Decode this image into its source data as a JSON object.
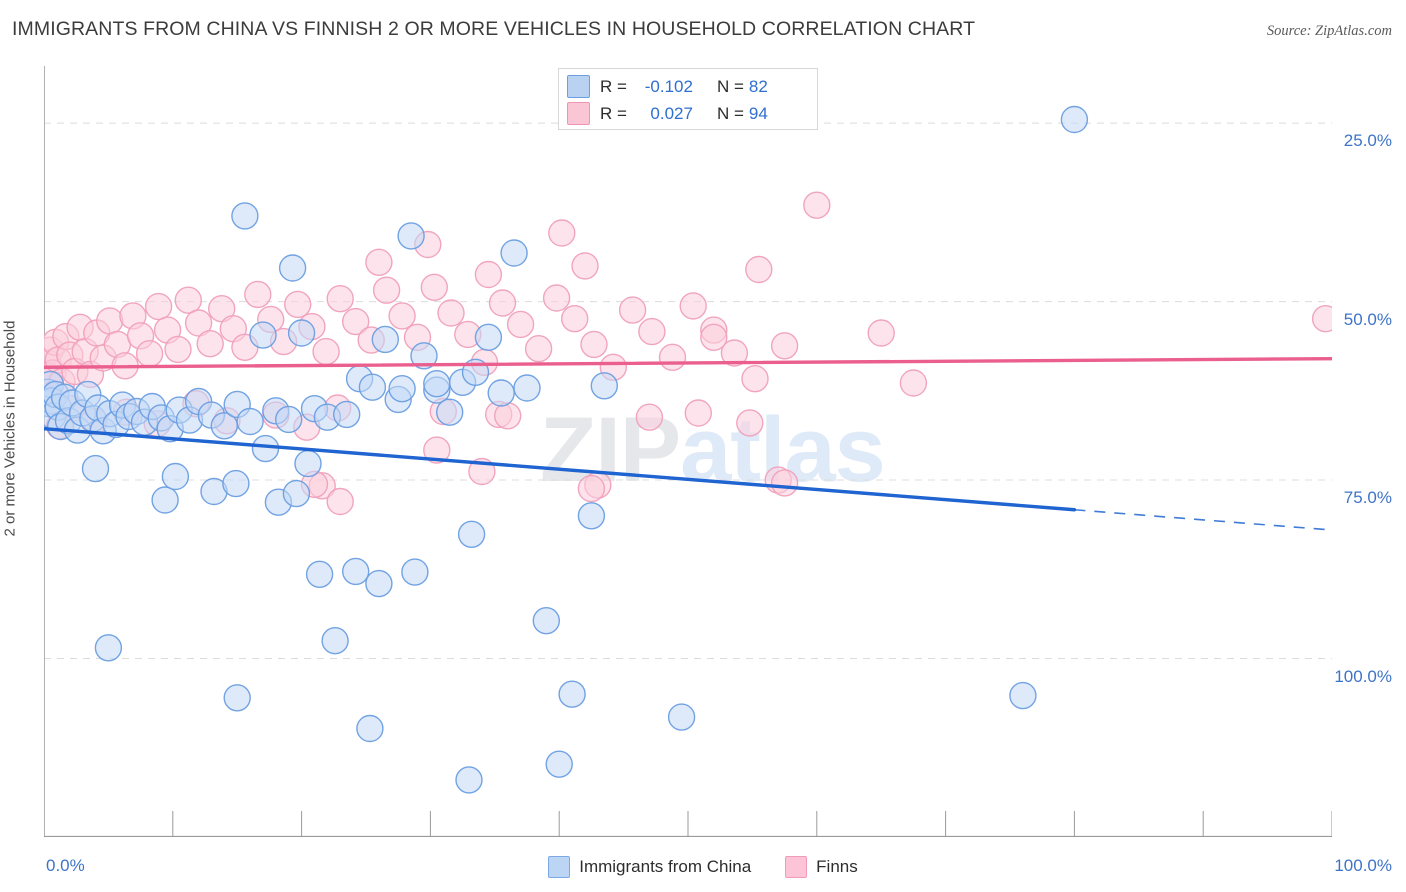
{
  "title": "IMMIGRANTS FROM CHINA VS FINNISH 2 OR MORE VEHICLES IN HOUSEHOLD CORRELATION CHART",
  "source": "Source: ZipAtlas.com",
  "watermark": {
    "part1": "ZIP",
    "part2": "atlas"
  },
  "colors": {
    "blue_fill": "#c3d8f5",
    "blue_stroke": "#6a9ee2",
    "blue_line": "#1f64d0",
    "pink_fill": "#fccedd",
    "pink_stroke": "#f0a0ba",
    "pink_line": "#ea5f8e",
    "axis_label": "#3e74c8",
    "gridline": "#dcdcdc"
  },
  "correlation_legend": [
    {
      "series": "Immigrants from China",
      "swatch": "blue",
      "r_label": "R =",
      "r_value": "-0.102",
      "n_label": "N =",
      "n_value": "82"
    },
    {
      "series": "Finns",
      "swatch": "pink",
      "r_label": "R =",
      "r_value": "0.027",
      "n_label": "N =",
      "n_value": "94"
    }
  ],
  "series_legend": [
    {
      "label": "Immigrants from China",
      "swatch": "blue"
    },
    {
      "label": "Finns",
      "swatch": "pink"
    }
  ],
  "axes": {
    "y_title": "2 or more Vehicles in Household",
    "y_ticks": [
      "100.0%",
      "75.0%",
      "50.0%",
      "25.0%"
    ],
    "x_min_label": "0.0%",
    "x_max_label": "100.0%"
  },
  "chart_data": {
    "type": "scatter",
    "title": "IMMIGRANTS FROM CHINA VS FINNISH 2 OR MORE VEHICLES IN HOUSEHOLD CORRELATION CHART",
    "xlabel": "",
    "ylabel": "2 or more Vehicles in Household",
    "xlim": [
      0,
      100
    ],
    "ylim": [
      0,
      108
    ],
    "x_ticks": [
      0,
      10,
      20,
      30,
      40,
      50,
      60,
      70,
      80,
      90,
      100
    ],
    "y_ticks": [
      25,
      50,
      75,
      100
    ],
    "grid": true,
    "legend_position": "bottom-center",
    "series": [
      {
        "name": "Immigrants from China",
        "color": "#c3d8f5",
        "r": -0.102,
        "n": 82,
        "trendline": {
          "x0": 0,
          "y0": 57.2,
          "x1": 100,
          "y1": 43.0,
          "solid_until_x": 80
        },
        "points": [
          [
            0.3,
            62.3
          ],
          [
            0.4,
            60.7
          ],
          [
            0.5,
            63.4
          ],
          [
            0.6,
            61.1
          ],
          [
            0.7,
            59.0
          ],
          [
            0.9,
            62.0
          ],
          [
            1.1,
            60.2
          ],
          [
            1.3,
            57.5
          ],
          [
            1.6,
            61.6
          ],
          [
            1.9,
            58.3
          ],
          [
            2.2,
            60.8
          ],
          [
            2.6,
            57.0
          ],
          [
            3.0,
            59.4
          ],
          [
            3.4,
            62.0
          ],
          [
            3.8,
            58.6
          ],
          [
            4.2,
            60.1
          ],
          [
            4.6,
            56.9
          ],
          [
            5.1,
            59.3
          ],
          [
            5.6,
            57.8
          ],
          [
            6.1,
            60.5
          ],
          [
            4.0,
            51.6
          ],
          [
            6.6,
            58.9
          ],
          [
            7.2,
            59.6
          ],
          [
            7.8,
            58.1
          ],
          [
            8.4,
            60.3
          ],
          [
            9.1,
            58.7
          ],
          [
            9.8,
            57.2
          ],
          [
            10.5,
            59.8
          ],
          [
            11.3,
            58.4
          ],
          [
            12.0,
            61.0
          ],
          [
            9.4,
            47.2
          ],
          [
            10.2,
            50.5
          ],
          [
            13.0,
            59.1
          ],
          [
            14.0,
            57.6
          ],
          [
            15.0,
            60.6
          ],
          [
            13.2,
            48.4
          ],
          [
            16.0,
            58.2
          ],
          [
            17.0,
            70.3
          ],
          [
            15.6,
            87.0
          ],
          [
            18.0,
            59.7
          ],
          [
            14.9,
            49.5
          ],
          [
            19.0,
            58.5
          ],
          [
            20.0,
            70.6
          ],
          [
            19.3,
            79.7
          ],
          [
            21.0,
            60.0
          ],
          [
            18.2,
            46.9
          ],
          [
            22.0,
            58.8
          ],
          [
            17.2,
            54.4
          ],
          [
            20.5,
            52.3
          ],
          [
            23.5,
            59.2
          ],
          [
            19.6,
            48.1
          ],
          [
            24.5,
            64.2
          ],
          [
            25.5,
            63.0
          ],
          [
            21.4,
            36.8
          ],
          [
            26.5,
            69.7
          ],
          [
            27.5,
            61.3
          ],
          [
            24.2,
            37.2
          ],
          [
            28.5,
            84.2
          ],
          [
            29.5,
            67.4
          ],
          [
            22.6,
            27.5
          ],
          [
            30.5,
            62.6
          ],
          [
            31.5,
            59.5
          ],
          [
            26.0,
            35.5
          ],
          [
            32.5,
            63.7
          ],
          [
            27.8,
            62.8
          ],
          [
            33.5,
            65.1
          ],
          [
            25.3,
            15.2
          ],
          [
            34.5,
            70.0
          ],
          [
            35.5,
            62.2
          ],
          [
            28.8,
            37.1
          ],
          [
            36.5,
            81.8
          ],
          [
            33.2,
            42.4
          ],
          [
            37.5,
            62.9
          ],
          [
            30.5,
            63.5
          ],
          [
            39.0,
            30.3
          ],
          [
            15.0,
            19.5
          ],
          [
            5.0,
            26.5
          ],
          [
            41.0,
            20.0
          ],
          [
            43.5,
            63.2
          ],
          [
            42.5,
            45.0
          ],
          [
            40.0,
            10.2
          ],
          [
            33.0,
            8.0
          ],
          [
            49.5,
            16.8
          ],
          [
            80.0,
            100.5
          ],
          [
            76.0,
            19.8
          ]
        ]
      },
      {
        "name": "Finns",
        "color": "#fccedd",
        "r": 0.027,
        "n": 94,
        "trendline": {
          "x0": 0,
          "y0": 65.8,
          "x1": 100,
          "y1": 67.0,
          "solid_until_x": 100
        },
        "points": [
          [
            0.3,
            66.4
          ],
          [
            0.4,
            64.5
          ],
          [
            0.5,
            68.2
          ],
          [
            0.7,
            65.0
          ],
          [
            0.9,
            69.3
          ],
          [
            1.1,
            66.8
          ],
          [
            1.4,
            63.8
          ],
          [
            1.7,
            70.1
          ],
          [
            2.0,
            67.5
          ],
          [
            2.4,
            65.2
          ],
          [
            2.8,
            71.4
          ],
          [
            3.2,
            68.0
          ],
          [
            3.6,
            64.8
          ],
          [
            4.1,
            70.6
          ],
          [
            4.6,
            67.1
          ],
          [
            5.1,
            72.3
          ],
          [
            5.7,
            69.0
          ],
          [
            6.3,
            66.0
          ],
          [
            6.9,
            73.0
          ],
          [
            7.5,
            70.2
          ],
          [
            8.2,
            67.7
          ],
          [
            8.9,
            74.3
          ],
          [
            9.6,
            71.0
          ],
          [
            10.4,
            68.3
          ],
          [
            11.2,
            75.2
          ],
          [
            12.0,
            72.0
          ],
          [
            12.9,
            69.1
          ],
          [
            13.8,
            74.0
          ],
          [
            14.7,
            71.2
          ],
          [
            15.6,
            68.6
          ],
          [
            16.6,
            76.0
          ],
          [
            17.6,
            72.5
          ],
          [
            18.6,
            69.4
          ],
          [
            19.7,
            74.6
          ],
          [
            20.8,
            71.5
          ],
          [
            21.9,
            68.0
          ],
          [
            23.0,
            75.4
          ],
          [
            24.2,
            72.2
          ],
          [
            25.4,
            69.6
          ],
          [
            26.6,
            76.6
          ],
          [
            27.8,
            73.0
          ],
          [
            29.0,
            70.0
          ],
          [
            30.3,
            77.0
          ],
          [
            31.6,
            73.4
          ],
          [
            32.9,
            70.4
          ],
          [
            34.2,
            66.5
          ],
          [
            35.6,
            74.8
          ],
          [
            37.0,
            71.8
          ],
          [
            38.4,
            68.4
          ],
          [
            39.8,
            75.5
          ],
          [
            41.2,
            72.6
          ],
          [
            42.7,
            69.0
          ],
          [
            44.2,
            65.8
          ],
          [
            45.7,
            73.8
          ],
          [
            47.2,
            70.8
          ],
          [
            48.8,
            67.2
          ],
          [
            50.4,
            74.4
          ],
          [
            52.0,
            71.0
          ],
          [
            53.6,
            67.8
          ],
          [
            55.2,
            64.2
          ],
          [
            26.0,
            80.5
          ],
          [
            29.8,
            83.0
          ],
          [
            34.5,
            78.8
          ],
          [
            40.2,
            84.6
          ],
          [
            42.0,
            80.0
          ],
          [
            18.0,
            59.1
          ],
          [
            20.4,
            57.4
          ],
          [
            22.8,
            60.1
          ],
          [
            14.2,
            58.3
          ],
          [
            11.8,
            60.7
          ],
          [
            8.8,
            57.9
          ],
          [
            6.4,
            59.5
          ],
          [
            3.9,
            58.2
          ],
          [
            2.1,
            60.0
          ],
          [
            1.2,
            57.6
          ],
          [
            21.6,
            49.2
          ],
          [
            21.0,
            49.4
          ],
          [
            23.0,
            47.0
          ],
          [
            34.0,
            51.2
          ],
          [
            30.5,
            54.2
          ],
          [
            31.0,
            59.6
          ],
          [
            35.3,
            59.2
          ],
          [
            36.0,
            59.0
          ],
          [
            43.0,
            49.3
          ],
          [
            42.5,
            48.8
          ],
          [
            47.0,
            58.8
          ],
          [
            50.8,
            59.4
          ],
          [
            54.8,
            58.0
          ],
          [
            57.0,
            50.0
          ],
          [
            57.5,
            49.6
          ],
          [
            52.0,
            70.0
          ],
          [
            57.5,
            68.8
          ],
          [
            60.0,
            88.5
          ],
          [
            55.5,
            79.5
          ],
          [
            65.0,
            70.6
          ],
          [
            67.5,
            63.6
          ],
          [
            99.5,
            72.6
          ]
        ]
      }
    ]
  }
}
